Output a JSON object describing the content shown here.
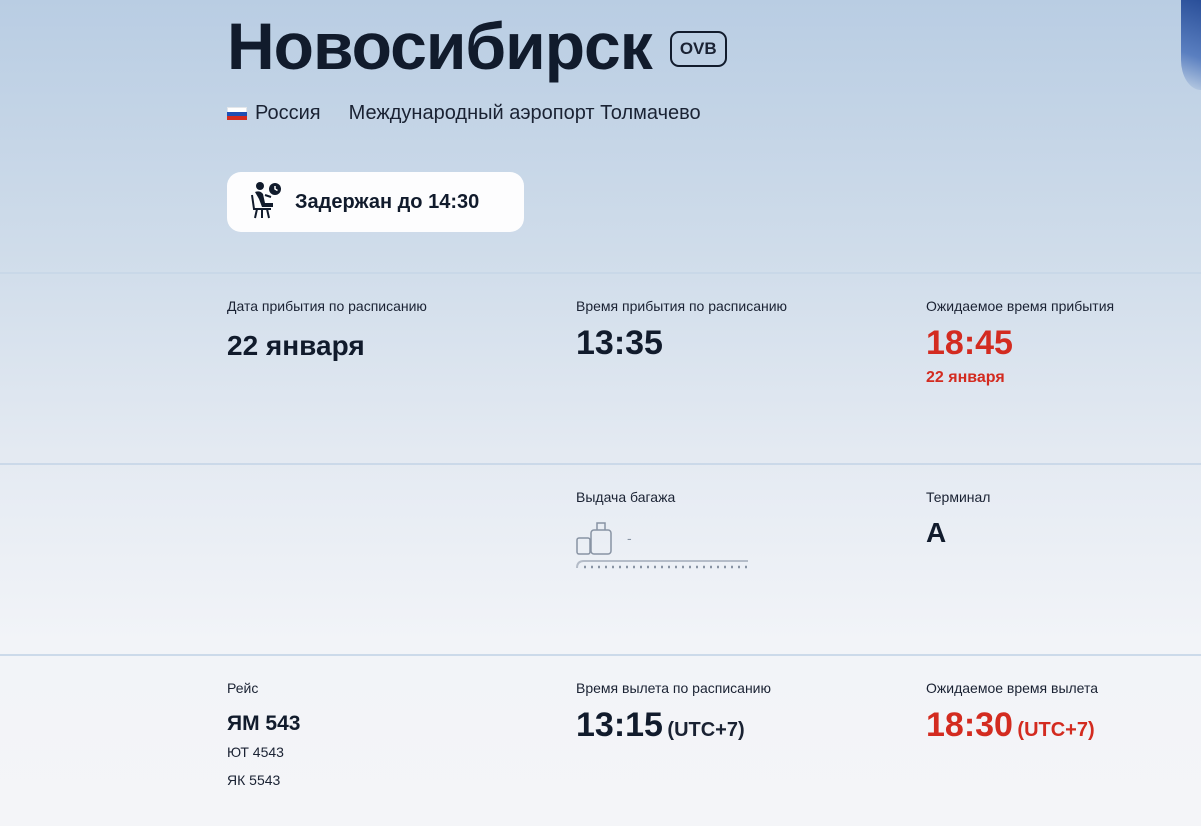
{
  "header": {
    "city": "Новосибирск",
    "code": "OVB",
    "country": "Россия",
    "airport": "Международный аэропорт Толмачево",
    "status": "Задержан до 14:30"
  },
  "colors": {
    "delay": "#d32b20",
    "text": "#111b2c"
  },
  "arrival": {
    "sched_date_label": "Дата прибытия по расписанию",
    "sched_date": "22 января",
    "sched_time_label": "Время прибытия по расписанию",
    "sched_time": "13:35",
    "expected_label": "Ожидаемое время прибытия",
    "expected_time": "18:45",
    "expected_date": "22 января"
  },
  "baggage": {
    "label": "Выдача багажа",
    "value": "-"
  },
  "terminal": {
    "label": "Терминал",
    "value": "A"
  },
  "flight": {
    "label": "Рейс",
    "number": "ЯМ 543",
    "codeshares": [
      "ЮТ 4543",
      "ЯК 5543"
    ]
  },
  "departure": {
    "sched_label": "Время вылета по расписанию",
    "sched_time": "13:15",
    "sched_tz": "(UTC+7)",
    "expected_label": "Ожидаемое время вылета",
    "expected_time": "18:30",
    "expected_tz": "(UTC+7)"
  },
  "icons": {
    "status": "waiting-passenger-clock-icon",
    "baggage": "luggage-belt-icon",
    "flag": "russia-flag-icon"
  }
}
